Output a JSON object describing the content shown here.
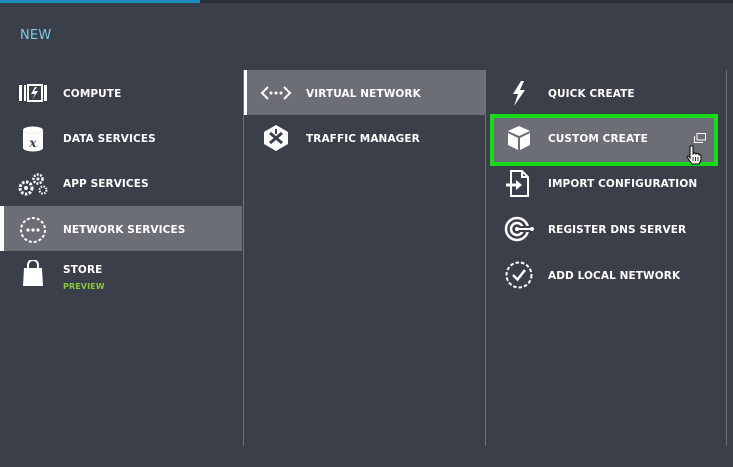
{
  "header": {
    "title": "NEW"
  },
  "categories": [
    {
      "label": "COMPUTE",
      "icon": "compute-icon"
    },
    {
      "label": "DATA SERVICES",
      "icon": "data-services-icon"
    },
    {
      "label": "APP SERVICES",
      "icon": "gears-icon"
    },
    {
      "label": "NETWORK SERVICES",
      "icon": "network-services-icon",
      "selected": true
    },
    {
      "label": "STORE",
      "sublabel": "PREVIEW",
      "icon": "shopping-bag-icon"
    }
  ],
  "network_items": [
    {
      "label": "VIRTUAL NETWORK",
      "icon": "virtual-network-icon",
      "selected": true
    },
    {
      "label": "TRAFFIC MANAGER",
      "icon": "traffic-manager-icon"
    }
  ],
  "actions": [
    {
      "label": "QUICK CREATE",
      "icon": "lightning-icon"
    },
    {
      "label": "CUSTOM CREATE",
      "icon": "box-icon",
      "highlighted": true
    },
    {
      "label": "IMPORT CONFIGURATION",
      "icon": "import-icon"
    },
    {
      "label": "REGISTER DNS SERVER",
      "icon": "dns-icon"
    },
    {
      "label": "ADD LOCAL NETWORK",
      "icon": "check-circle-icon"
    }
  ],
  "colors": {
    "background": "#3b3f4a",
    "selected": "#6b6e74",
    "title": "#7fc8ea",
    "preview": "#8cc63f",
    "highlight_border": "#19d81c",
    "accent": "#1e8cc2"
  }
}
